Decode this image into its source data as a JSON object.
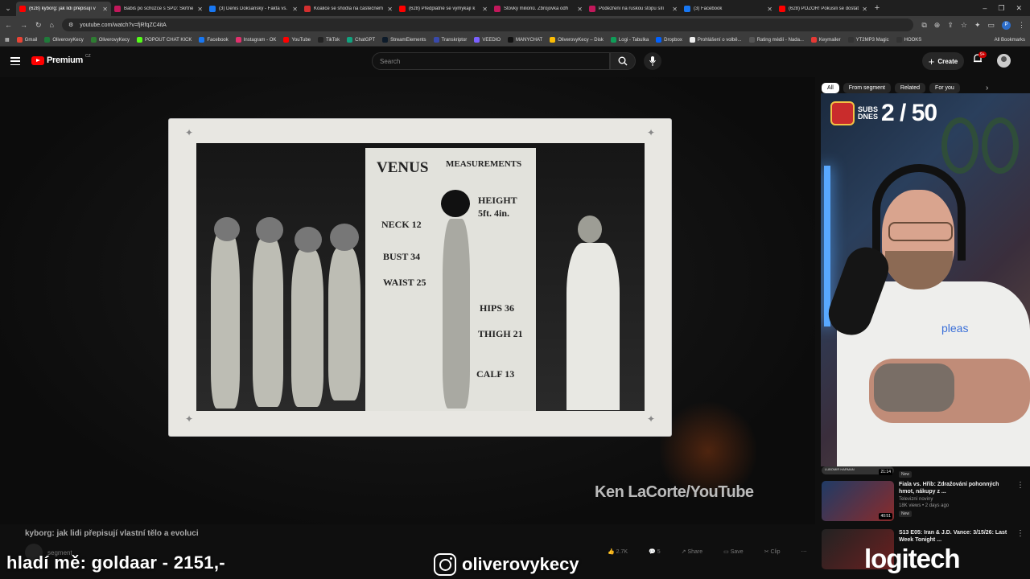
{
  "browser": {
    "tabs": [
      {
        "title": "(628) kyborg: jak lidi přepisují v",
        "fav": "#ff0000",
        "active": true
      },
      {
        "title": "Babiš po schůzce s SPD: Škrtne",
        "fav": "#c2185b",
        "active": false
      },
      {
        "title": "(3) Denis Doksanský - Fakta vs.",
        "fav": "#1877f2",
        "active": false
      },
      {
        "title": "Koalice se shodla na částečném",
        "fav": "#d32f2f",
        "active": false
      },
      {
        "title": "(628) Předplatné se vymykají k",
        "fav": "#ff0000",
        "active": false
      },
      {
        "title": "Stovky milionů. Zbrojovka odh",
        "fav": "#c2185b",
        "active": false
      },
      {
        "title": "Podezření na ruskou stopu sílí",
        "fav": "#c2185b",
        "active": false
      },
      {
        "title": "(3) Facebook",
        "fav": "#1877f2",
        "active": false
      },
      {
        "title": "(628) POZOR! Pokusili se dostat",
        "fav": "#ff0000",
        "active": false
      }
    ],
    "url": "youtube.com/watch?v=fjRfqZC4itA",
    "profile_letter": "P",
    "bookmarks": [
      {
        "label": "Gmail",
        "color": "#ea4335"
      },
      {
        "label": "OliverovyKecy",
        "color": "#1f7a3a"
      },
      {
        "label": "OliverovyKecy",
        "color": "#2e7d32"
      },
      {
        "label": "POPOUT CHAT KICK",
        "color": "#53fc18"
      },
      {
        "label": "Facebook",
        "color": "#1877f2"
      },
      {
        "label": "Instagram - OK",
        "color": "#e1306c"
      },
      {
        "label": "YouTube",
        "color": "#ff0000"
      },
      {
        "label": "TikTok",
        "color": "#222222"
      },
      {
        "label": "ChatGPT",
        "color": "#10a37f"
      },
      {
        "label": "StreamElements",
        "color": "#0d1b2a"
      },
      {
        "label": "Transkriptor",
        "color": "#3949ab"
      },
      {
        "label": "VEEDIO",
        "color": "#7b61ff"
      },
      {
        "label": "MANYCHAT",
        "color": "#111111"
      },
      {
        "label": "OliverovyKecy – Disk",
        "color": "#fbbc04"
      },
      {
        "label": "Logi - Tabulka",
        "color": "#0f9d58"
      },
      {
        "label": "Dropbox",
        "color": "#0061ff"
      },
      {
        "label": "Prohlášení o volbě...",
        "color": "#eeeeee"
      },
      {
        "label": "Rating médií - Nada...",
        "color": "#555555"
      },
      {
        "label": "Keymailer",
        "color": "#e53935"
      },
      {
        "label": "YT2MP3 Magic",
        "color": "#333333"
      },
      {
        "label": "HOOKS",
        "color": "#333333"
      }
    ],
    "all_bookmarks": "All Bookmarks"
  },
  "yt": {
    "logo_text": "Premium",
    "country": "CZ",
    "search_placeholder": "Search",
    "create_label": "Create",
    "notif_count": "9+",
    "chips": [
      {
        "label": "All",
        "active": true
      },
      {
        "label": "From segment",
        "active": false
      },
      {
        "label": "Related",
        "active": false
      },
      {
        "label": "For you",
        "active": false
      }
    ]
  },
  "video": {
    "poster_title": "VENUS",
    "poster_subtitle": "MEASUREMENTS",
    "measurements": [
      "NECK 12",
      "BUST 34",
      "WAIST 25",
      "HEIGHT",
      "5ft. 4in.",
      "HIPS 36",
      "THIGH 21",
      "CALF 13"
    ],
    "credit": "Ken LaCorte/YouTube",
    "title": "kyborg: jak lidi přepisují vlastní tělo a evoluci",
    "channel": "segment",
    "likes": "2.7K",
    "comments": "5",
    "share": "Share",
    "save": "Save",
    "clip": "Clip"
  },
  "stream": {
    "subs_label_1": "SUBS",
    "subs_label_2": "DNES",
    "subs_count": "2 / 50",
    "shirt_text": "pleas",
    "overlay_left": "hladí mě: goldaar - 2151,-",
    "instagram": "oliverovykecy",
    "sponsor": "logitech"
  },
  "recommendations": [
    {
      "title": "",
      "meta": "LUBOMIR HARMAN",
      "duration": "21:14",
      "badge": "New"
    },
    {
      "title": "Fiala vs. Hřib: Zdražování pohonných hmot, nákupy z ...",
      "channel": "Televizní noviny",
      "meta": "18K views • 2 days ago",
      "duration": "40:51",
      "badge": "New"
    },
    {
      "title": "S13 E05: Iran & J.D. Vance: 3/15/26: Last Week Tonight ...",
      "channel": "",
      "meta": "",
      "duration": "",
      "badge": ""
    }
  ]
}
